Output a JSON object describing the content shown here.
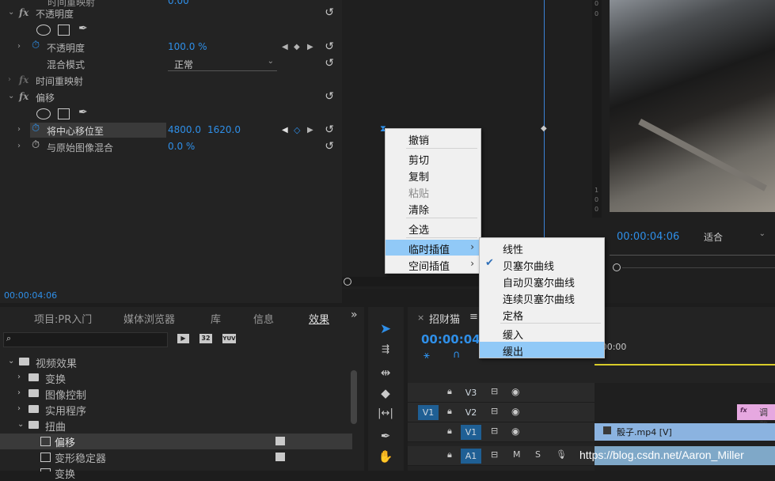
{
  "effect_controls": {
    "top_partial": "时间重映射",
    "opacity": {
      "title": "不透明度",
      "param": "不透明度",
      "value": "100.0 %",
      "blend_label": "混合模式",
      "blend_value": "正常"
    },
    "time_remap": "时间重映射",
    "offset": {
      "title": "偏移",
      "param1": "将中心移位至",
      "x": "4800.0",
      "y": "1620.0",
      "param2": "与原始图像混合",
      "mix": "0.0 %"
    },
    "timecode": "00:00:04:06"
  },
  "monitor": {
    "timecode": "00:00:04:06",
    "fit": "适合"
  },
  "effects_panel": {
    "tabs": [
      "项目:PR入门",
      "媒体浏览器",
      "库",
      "信息",
      "效果"
    ],
    "overflow": "»",
    "icons": [
      "accelerated-icon",
      "32",
      "YUV"
    ],
    "tree": [
      {
        "label": "视频效果",
        "level": 0,
        "expanded": true
      },
      {
        "label": "变换",
        "level": 1
      },
      {
        "label": "图像控制",
        "level": 1
      },
      {
        "label": "实用程序",
        "level": 1
      },
      {
        "label": "扭曲",
        "level": 1,
        "expanded": true
      },
      {
        "label": "偏移",
        "level": 2,
        "selected": true
      },
      {
        "label": "变形稳定器",
        "level": 2
      },
      {
        "label": "变换",
        "level": 2
      }
    ]
  },
  "timeline": {
    "close": "×",
    "sequence": "招财猫",
    "menu": "≡",
    "timecode": "00:00:04:0",
    "ruler_time": ":00:00",
    "clip_adjust": "调整",
    "clip_video": "骰子.mp4 [V]",
    "tracks": [
      "V3",
      "V2",
      "V1",
      "A1"
    ],
    "source_label": "V1",
    "a1_m": "M",
    "a1_s": "S"
  },
  "context_menu": {
    "items": [
      "撤销",
      "剪切",
      "复制",
      "粘贴",
      "清除",
      "全选",
      "临时插值",
      "空间插值"
    ]
  },
  "submenu": {
    "items": [
      "线性",
      "贝塞尔曲线",
      "自动贝塞尔曲线",
      "连续贝塞尔曲线",
      "定格",
      "缓入",
      "缓出"
    ],
    "checked": "贝塞尔曲线"
  },
  "watermark": "https://blog.csdn.net/Aaron_Miller",
  "colors": {
    "accent": "#2f8fe8",
    "menu_highlight": "#91c9f7",
    "playhead": "#3b82d6"
  }
}
